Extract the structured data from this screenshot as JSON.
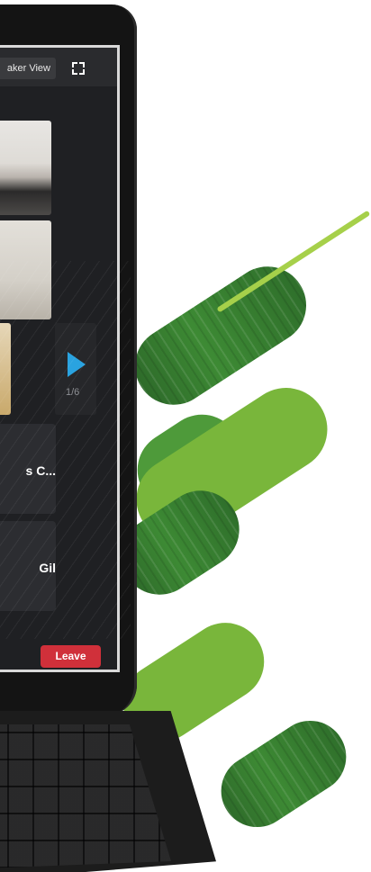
{
  "meeting": {
    "view_label": "aker View",
    "page_indicator": "1/6",
    "participant_1": "s C...",
    "participant_2": "Gil",
    "leave_label": "Leave"
  },
  "colors": {
    "leave_button": "#d0303a",
    "next_arrow": "#2aa3e0",
    "green_dark": "#2e6b2a",
    "green_light": "#79b63b",
    "lime_line": "#a6d04a"
  },
  "icons": {
    "fullscreen": "fullscreen-icon",
    "next_page": "play-icon"
  }
}
